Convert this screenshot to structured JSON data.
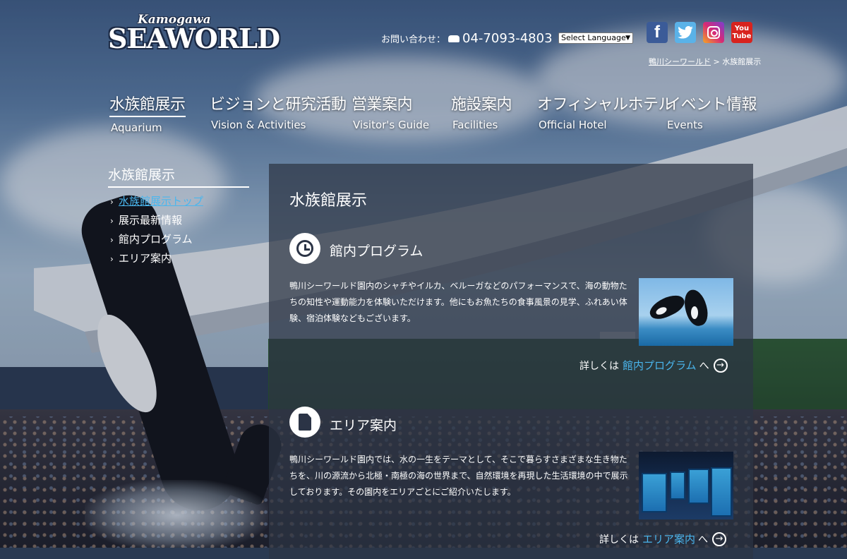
{
  "header": {
    "logo_small": "Kamogawa",
    "logo_big": "SEAWORLD",
    "contact_label": "お問い合わせ：",
    "phone": "04-7093-4803",
    "language_select": "Select Language",
    "social": [
      {
        "name": "facebook",
        "glyph": "f"
      },
      {
        "name": "twitter",
        "glyph": "🐦"
      },
      {
        "name": "instagram",
        "glyph": ""
      },
      {
        "name": "youtube",
        "glyph_top": "You",
        "glyph_bottom": "Tube"
      }
    ],
    "breadcrumb": {
      "home": "鴨川シーワールド",
      "separator": " > ",
      "current": "水族館展示"
    }
  },
  "nav": [
    {
      "jp": "水族館展示",
      "en": "Aquarium",
      "active": true
    },
    {
      "jp": "ビジョンと研究活動",
      "en": "Vision & Activities"
    },
    {
      "jp": "営業案内",
      "en": "Visitor's Guide"
    },
    {
      "jp": "施設案内",
      "en": "Facilities"
    },
    {
      "jp": "オフィシャルホテル",
      "en": "Official Hotel"
    },
    {
      "jp": "イベント情報",
      "en": "Events"
    }
  ],
  "sidebar": {
    "title": "水族館展示",
    "items": [
      {
        "label": "水族館展示トップ",
        "current": true
      },
      {
        "label": "展示最新情報"
      },
      {
        "label": "館内プログラム"
      },
      {
        "label": "エリア案内"
      }
    ]
  },
  "main": {
    "title": "水族館展示",
    "sections": [
      {
        "icon": "clock-icon",
        "title": "館内プログラム",
        "text": "鴨川シーワールド園内のシャチやイルカ、ベルーガなどのパフォーマンスで、海の動物たちの知性や運動能力を体験いただけます。他にもお魚たちの食事風景の見学、ふれあい体験、宿泊体験などもございます。",
        "more_prefix": "詳しくは",
        "more_link": "館内プログラム",
        "more_suffix": "へ"
      },
      {
        "icon": "document-icon",
        "title": "エリア案内",
        "text": "鴨川シーワールド園内では、水の一生をテーマとして、そこで暮らすさまざまな生き物たちを、川の源流から北極・南極の海の世界まで、自然環境を再現した生活環境の中で展示しております。その園内をエリアごとにご紹介いたします。",
        "more_prefix": "詳しくは",
        "more_link": "エリア案内",
        "more_suffix": "へ"
      }
    ]
  },
  "colors": {
    "link_accent": "#4ab6ee",
    "panel": "rgba(45,52,68,0.72)"
  }
}
